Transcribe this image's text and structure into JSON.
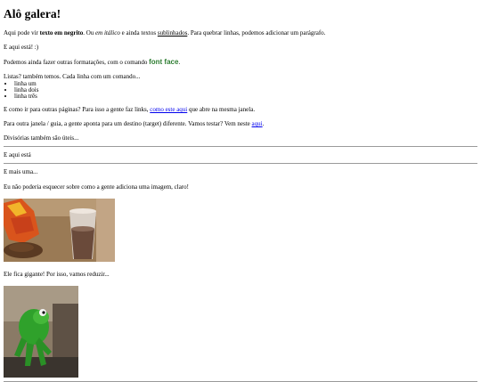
{
  "heading": "Alô galera!",
  "intro": {
    "p1": "Aqui pode vir ",
    "bold": "texto em negrito",
    "p2": ". Ou ",
    "italic": "em itálico",
    "p3": " e ainda textos ",
    "underlined": "sublinhados",
    "p4": ". Para quebrar linhas, podemos adicionar um parágrafo."
  },
  "line_here": "E aqui está! :)",
  "formatting": {
    "text": "Podemos ainda fazer outras formatações, com o comando ",
    "font_face": "font face",
    "end": "."
  },
  "lists_intro": "Listas? também temos. Cada linha com um comando...",
  "list_items": [
    "linha um",
    "linha dois",
    "linha três"
  ],
  "links": {
    "p1": "E como ir para outras páginas? Para isso a gente faz links, ",
    "link1": "como este aqui",
    "p2": " que abre na mesma janela."
  },
  "links2": {
    "p1": "Para outra janela / guia, a gente aponta para um destino (target) diferente. Vamos testar? Vem neste ",
    "link2": "aqui",
    "p2": "."
  },
  "dividers_text": "Divisórias também são úteis...",
  "here_it_is": "E aqui está",
  "and_more": "E mais uma...",
  "image_intro": "Eu não poderia esquecer sobre como a gente adiciona uma imagem, claro!",
  "giant_text": "Ele fica gigante! Por isso, vamos reduzir..."
}
